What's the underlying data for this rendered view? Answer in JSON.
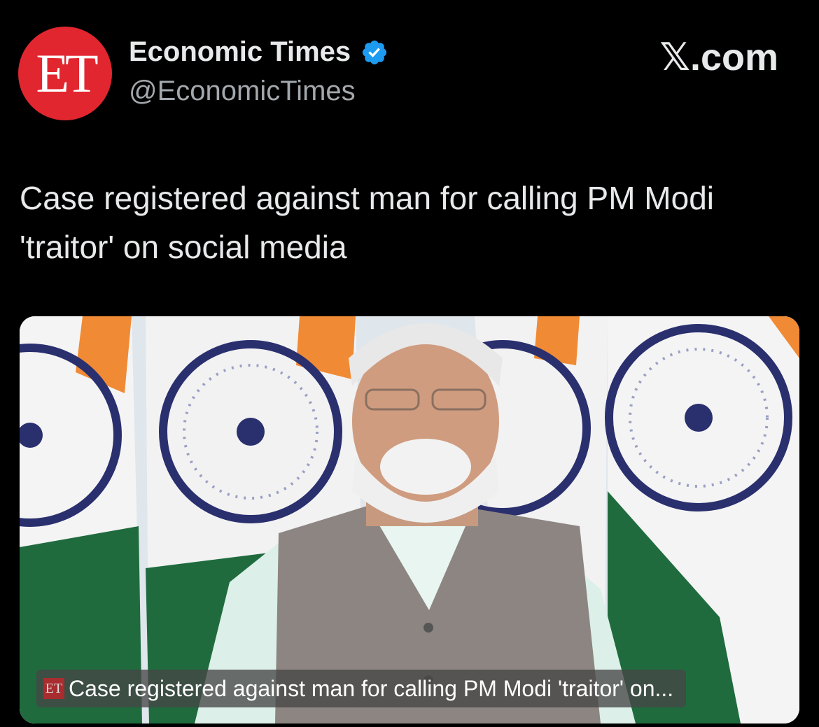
{
  "account": {
    "avatar_text": "ET",
    "display_name": "Economic Times",
    "handle": "@EconomicTimes",
    "verified_icon": "verified-badge-icon",
    "verified_color": "#1d9bf0"
  },
  "brand": {
    "label": "𝕏.com"
  },
  "tweet": {
    "text": "Case registered against man for calling PM Modi 'traitor' on social media"
  },
  "media": {
    "caption": "Case registered against man for calling PM Modi 'traitor' on...",
    "caption_logo": "ET"
  },
  "colors": {
    "background": "#000000",
    "avatar_red": "#e1262f",
    "saffron": "#f08a34",
    "green": "#1f6b3e",
    "chakra_blue": "#2a2f6e"
  }
}
